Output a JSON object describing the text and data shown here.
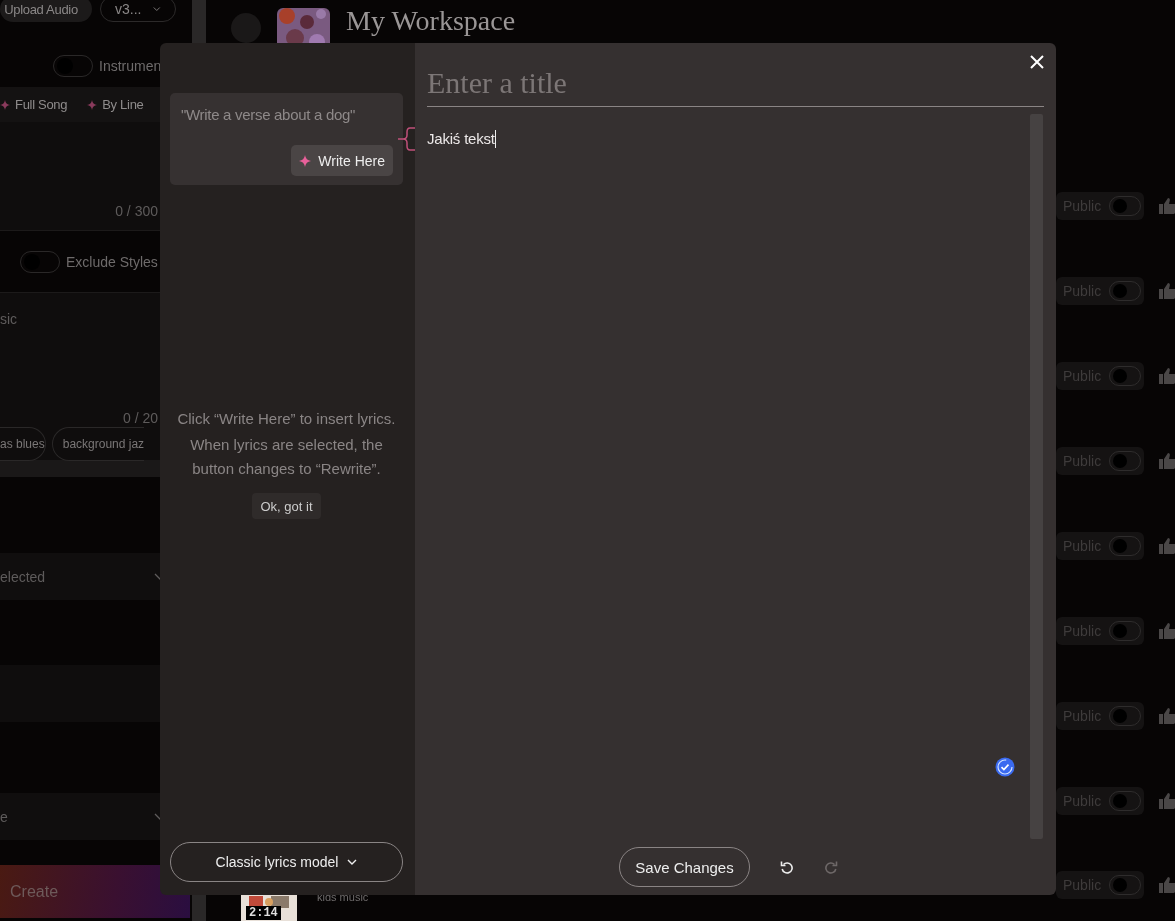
{
  "sidebar": {
    "upload_button": "Upload Audio",
    "version_select": "v3...",
    "instrumental": {
      "label": "Instrumen",
      "on": false
    },
    "lyrics_modes": [
      {
        "label": "Full Song"
      },
      {
        "label": "By Line"
      }
    ],
    "lyrics_counter": "0 / 300",
    "exclude_styles": {
      "label": "Exclude Styles",
      "on": false
    },
    "styles_placeholder": "sic",
    "styles_counter": "0 / 20",
    "style_chips": [
      "as blues",
      "background jaz"
    ],
    "selects": [
      "elected",
      "e"
    ],
    "create_button": "Create"
  },
  "workspace": {
    "title": "My Workspace",
    "songs": [
      {
        "public_label": "Public",
        "public": false
      },
      {
        "public_label": "Public",
        "public": false
      },
      {
        "public_label": "Public",
        "public": false
      },
      {
        "public_label": "Public",
        "public": false
      },
      {
        "public_label": "Public",
        "public": false
      },
      {
        "public_label": "Public",
        "public": false
      },
      {
        "public_label": "Public",
        "public": false
      },
      {
        "public_label": "Public",
        "public": false
      },
      {
        "public_label": "Public",
        "public": false,
        "duration": "2:14",
        "genre": "kids music"
      }
    ]
  },
  "modal": {
    "prompt_example": "\"Write a verse about a dog\"",
    "write_button": "Write Here",
    "hint_lines": [
      "Click “Write Here” to insert lyrics.",
      "When lyrics are selected, the button changes to “Rewrite”."
    ],
    "ok_button": "Ok, got it",
    "model_select": "Classic lyrics model",
    "title_placeholder": "Enter a title",
    "lyrics_text": "Jakiś tekst",
    "save_button": "Save Changes",
    "undo": {
      "disabled": false
    },
    "redo": {
      "disabled": true
    }
  }
}
